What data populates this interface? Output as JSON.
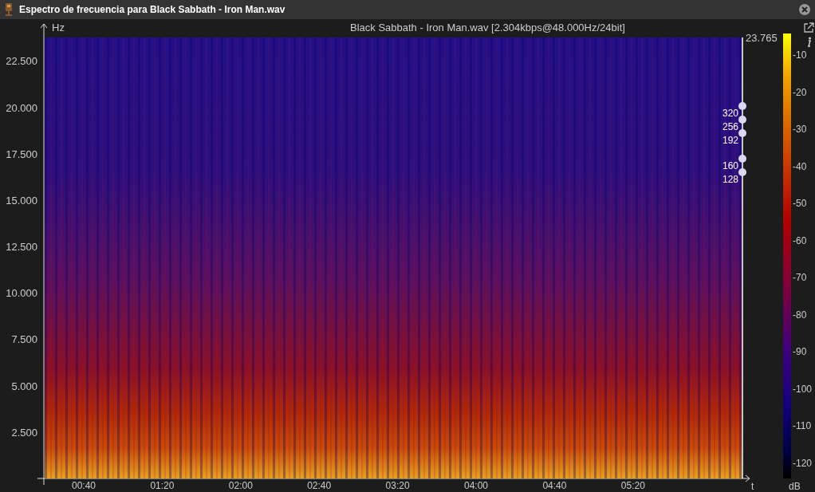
{
  "window": {
    "title": "Espectro de frecuencia para Black Sabbath - Iron Man.wav"
  },
  "plot": {
    "y_unit": "Hz",
    "x_unit": "t",
    "title": "Black Sabbath - Iron Man.wav [2.304kbps@48.000Hz/24bit]",
    "max_frequency": "23.765",
    "y_ticks": [
      "22.500",
      "20.000",
      "17.500",
      "15.000",
      "12.500",
      "10.000",
      "7.500",
      "5.000",
      "2.500"
    ],
    "x_ticks": [
      "00:40",
      "01:20",
      "02:00",
      "02:40",
      "03:20",
      "04:00",
      "04:40",
      "05:20"
    ],
    "bitrate_markers": [
      "320",
      "256",
      "192",
      "160",
      "128"
    ]
  },
  "color_scale": {
    "unit": "dB",
    "ticks": [
      "-10",
      "-20",
      "-30",
      "-40",
      "-50",
      "-60",
      "-70",
      "-80",
      "-90",
      "-100",
      "-110",
      "-120"
    ]
  }
}
